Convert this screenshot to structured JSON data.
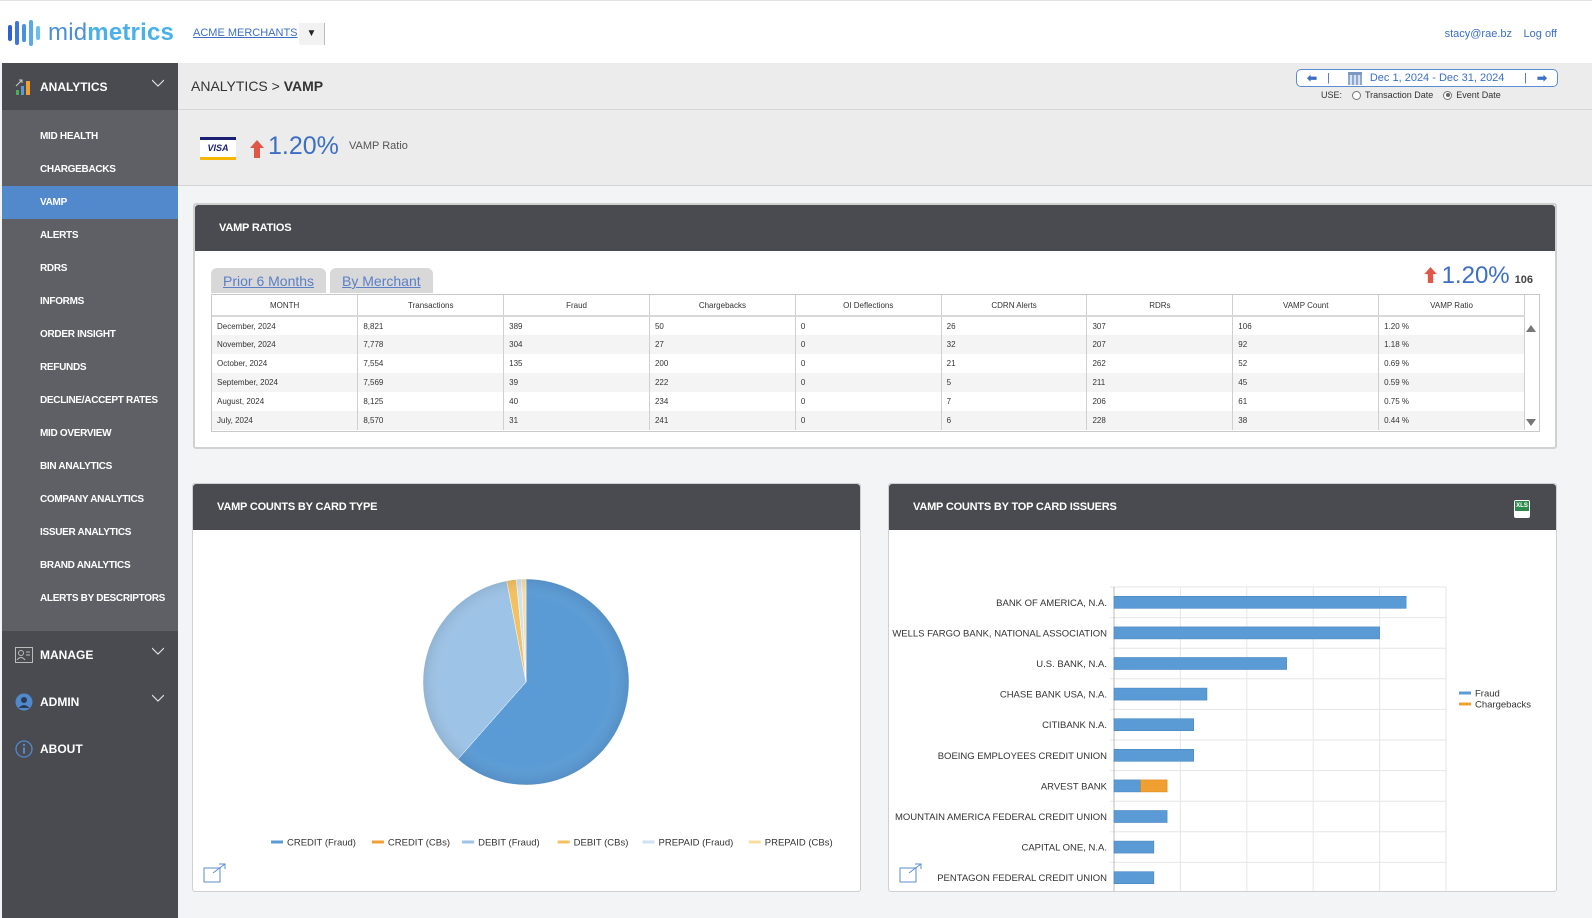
{
  "app": {
    "brand_light": "mid",
    "brand_bold": "metrics",
    "merchant": "ACME MERCHANTS",
    "merchant_dropdown_icon": "caret-down-icon",
    "user_email": "stacy@rae.bz",
    "logoff": "Log off"
  },
  "sidebar": {
    "sections": [
      {
        "label": "ANALYTICS",
        "icon": "analytics-chart-icon",
        "expanded": true
      },
      {
        "label": "MANAGE",
        "icon": "id-card-icon",
        "expanded": false
      },
      {
        "label": "ADMIN",
        "icon": "user-icon",
        "expanded": false
      },
      {
        "label": "ABOUT",
        "icon": "info-icon"
      }
    ],
    "items": [
      {
        "label": "MID HEALTH"
      },
      {
        "label": "CHARGEBACKS"
      },
      {
        "label": "VAMP",
        "active": true
      },
      {
        "label": "ALERTS"
      },
      {
        "label": "RDRS"
      },
      {
        "label": "INFORMS"
      },
      {
        "label": "ORDER INSIGHT"
      },
      {
        "label": "REFUNDS"
      },
      {
        "label": "DECLINE/ACCEPT RATES"
      },
      {
        "label": "MID OVERVIEW"
      },
      {
        "label": "BIN ANALYTICS"
      },
      {
        "label": "COMPANY ANALYTICS"
      },
      {
        "label": "ISSUER ANALYTICS"
      },
      {
        "label": "BRAND ANALYTICS"
      },
      {
        "label": "ALERTS BY DESCRIPTORS"
      }
    ]
  },
  "breadcrumb": {
    "parent": "ANALYTICS",
    "separator": ">",
    "current": "VAMP"
  },
  "date_range": {
    "prev_icon": "arrow-left-icon",
    "next_icon": "arrow-right-icon",
    "calendar_icon": "calendar-icon",
    "start": "Dec 1, 2024",
    "dash": "-",
    "end": "Dec 31, 2024",
    "use_label": "USE:",
    "options": [
      {
        "label": "Transaction Date",
        "selected": false
      },
      {
        "label": "Event Date",
        "selected": true
      }
    ]
  },
  "kpi": {
    "card_brand": "VISA",
    "trend": "up",
    "value": "1.20%",
    "label": "VAMP Ratio"
  },
  "vamp_ratios": {
    "title": "VAMP RATIOS",
    "tabs": [
      "Prior 6 Months",
      "By Merchant"
    ],
    "summary_value": "1.20%",
    "summary_count": "106",
    "columns": [
      "MONTH",
      "Transactions",
      "Fraud",
      "Chargebacks",
      "OI Deflections",
      "CDRN Alerts",
      "RDRs",
      "VAMP Count",
      "VAMP Ratio"
    ],
    "rows": [
      [
        "December, 2024",
        "8,821",
        "389",
        "50",
        "0",
        "26",
        "307",
        "106",
        "1.20 %"
      ],
      [
        "November, 2024",
        "7,778",
        "304",
        "27",
        "0",
        "32",
        "207",
        "92",
        "1.18 %"
      ],
      [
        "October, 2024",
        "7,554",
        "135",
        "200",
        "0",
        "21",
        "262",
        "52",
        "0.69 %"
      ],
      [
        "September, 2024",
        "7,569",
        "39",
        "222",
        "0",
        "5",
        "211",
        "45",
        "0.59 %"
      ],
      [
        "August, 2024",
        "8,125",
        "40",
        "234",
        "0",
        "7",
        "206",
        "61",
        "0.75 %"
      ],
      [
        "July, 2024",
        "8,570",
        "31",
        "241",
        "0",
        "6",
        "228",
        "38",
        "0.44 %"
      ]
    ]
  },
  "colors": {
    "accent": "#5189cc",
    "link": "#3c6fc4",
    "trend_up": "#e0574a",
    "panel_header": "#4a4b50",
    "sidebar": "#4a4b50",
    "sidebar_sub": "#5f6066"
  },
  "chart_data": [
    {
      "type": "pie",
      "title": "VAMP COUNTS BY CARD TYPE",
      "legend_position": "bottom",
      "slices": [
        {
          "label": "CREDIT (Fraud)",
          "value": 61.5,
          "color": "#5b9bd5"
        },
        {
          "label": "CREDIT (CBs)",
          "value": 0,
          "color": "#f0a030"
        },
        {
          "label": "DEBIT (Fraud)",
          "value": 35.5,
          "color": "#9dc3e6"
        },
        {
          "label": "DEBIT (CBs)",
          "value": 1.5,
          "color": "#f4c160"
        },
        {
          "label": "PREPAID (Fraud)",
          "value": 0.8,
          "color": "#cfe2f3"
        },
        {
          "label": "PREPAID (CBs)",
          "value": 0.7,
          "color": "#f9dca0"
        }
      ]
    },
    {
      "type": "bar",
      "orientation": "horizontal",
      "stacked": true,
      "title": "VAMP COUNTS BY TOP CARD ISSUERS",
      "legend_position": "right",
      "categories": [
        "BANK OF AMERICA, N.A.",
        "WELLS FARGO BANK, NATIONAL ASSOCIATION",
        "U.S. BANK, N.A.",
        "CHASE BANK USA, N.A.",
        "CITIBANK N.A.",
        "BOEING EMPLOYEES CREDIT UNION",
        "ARVEST BANK",
        "MOUNTAIN AMERICA FEDERAL CREDIT UNION",
        "CAPITAL ONE, N.A.",
        "PENTAGON FEDERAL CREDIT UNION"
      ],
      "series": [
        {
          "name": "Fraud",
          "color": "#5b9bd5",
          "values": [
            22,
            20,
            13,
            7,
            6,
            6,
            2,
            4,
            3,
            3
          ]
        },
        {
          "name": "Chargebacks",
          "color": "#f0a030",
          "values": [
            0,
            0,
            0,
            0,
            0,
            0,
            2,
            0,
            0,
            0
          ]
        }
      ],
      "xlim": [
        0,
        25
      ],
      "xticks": [
        0,
        5,
        10,
        15,
        20,
        25
      ],
      "grid": true
    }
  ]
}
